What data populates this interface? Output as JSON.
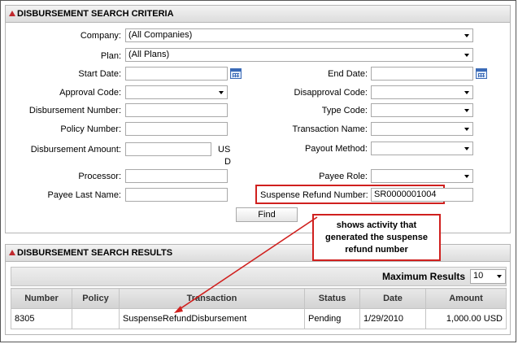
{
  "criteria": {
    "title": "DISBURSEMENT SEARCH CRITERIA",
    "company_label": "Company:",
    "company_value": "(All Companies)",
    "plan_label": "Plan:",
    "plan_value": "(All Plans)",
    "start_date_label": "Start Date:",
    "end_date_label": "End Date:",
    "approval_code_label": "Approval Code:",
    "disapproval_code_label": "Disapproval Code:",
    "disbursement_number_label": "Disbursement Number:",
    "type_code_label": "Type Code:",
    "policy_number_label": "Policy Number:",
    "transaction_name_label": "Transaction Name:",
    "disbursement_amount_label": "Disbursement Amount:",
    "currency_line1": "US",
    "currency_line2": "D",
    "payout_method_label": "Payout Method:",
    "processor_label": "Processor:",
    "payee_role_label": "Payee Role:",
    "payee_last_name_label": "Payee Last Name:",
    "suspense_refund_label": "Suspense Refund Number:",
    "suspense_refund_value": "SR0000001004",
    "find_label": "Find"
  },
  "callout": {
    "text": "shows activity that generated the suspense refund number",
    "color": "#d0201e"
  },
  "results": {
    "title": "DISBURSEMENT SEARCH RESULTS",
    "max_results_label": "Maximum Results",
    "max_results_value": "10",
    "columns": [
      "Number",
      "Policy",
      "Transaction",
      "Status",
      "Date",
      "Amount"
    ],
    "rows": [
      {
        "number": "8305",
        "policy": "",
        "transaction": "SuspenseRefundDisbursement",
        "status": "Pending",
        "date": "1/29/2010",
        "amount": "1,000.00 USD"
      }
    ]
  }
}
